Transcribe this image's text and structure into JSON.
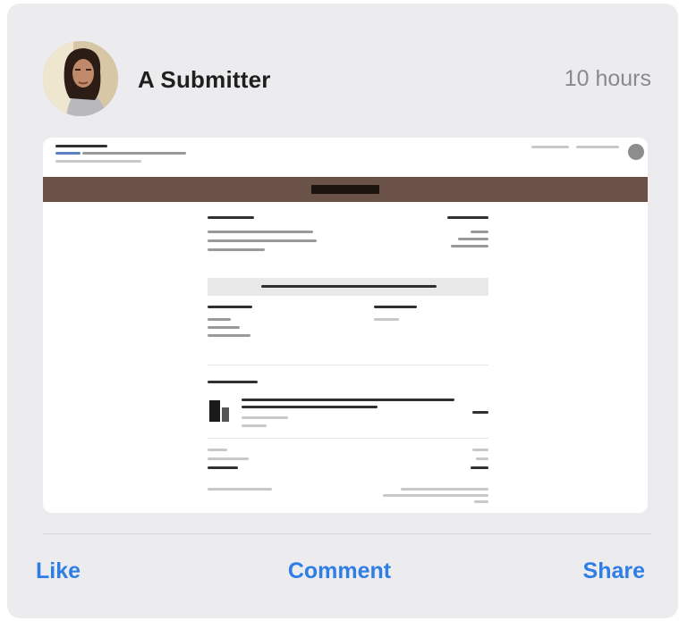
{
  "post": {
    "author": "A Submitter",
    "time": "10 hours"
  },
  "actions": {
    "like": "Like",
    "comment": "Comment",
    "share": "Share"
  },
  "colors": {
    "card_bg": "#ececef",
    "action_blue": "#2f7ee6",
    "banner_brown": "#6a5248",
    "time_gray": "#8a8a8e"
  },
  "icons": [
    "avatar-photo"
  ]
}
